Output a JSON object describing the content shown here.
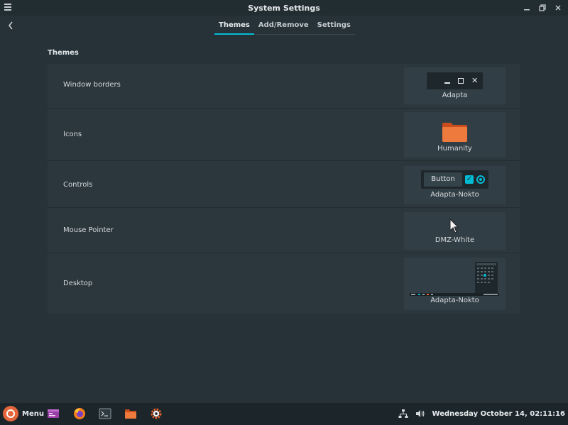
{
  "window": {
    "title": "System Settings"
  },
  "tabs": [
    {
      "label": "Themes",
      "active": true
    },
    {
      "label": "Add/Remove",
      "active": false
    },
    {
      "label": "Settings",
      "active": false
    }
  ],
  "section": {
    "title": "Themes"
  },
  "rows": [
    {
      "label": "Window borders",
      "value": "Adapta"
    },
    {
      "label": "Icons",
      "value": "Humanity"
    },
    {
      "label": "Controls",
      "value": "Adapta-Nokto",
      "button_label": "Button"
    },
    {
      "label": "Mouse Pointer",
      "value": "DMZ-White"
    },
    {
      "label": "Desktop",
      "value": "Adapta-Nokto"
    }
  ],
  "taskbar": {
    "menu_label": "Menu",
    "clock": "Wednesday October 14, 02:11:16",
    "launchers": [
      "show-desktop-icon",
      "firefox-icon",
      "terminal-icon",
      "files-icon",
      "settings-icon"
    ]
  },
  "colors": {
    "accent": "#00bcd4",
    "background": "#263238",
    "row": "#2b363d",
    "folder": "#e5622b"
  }
}
